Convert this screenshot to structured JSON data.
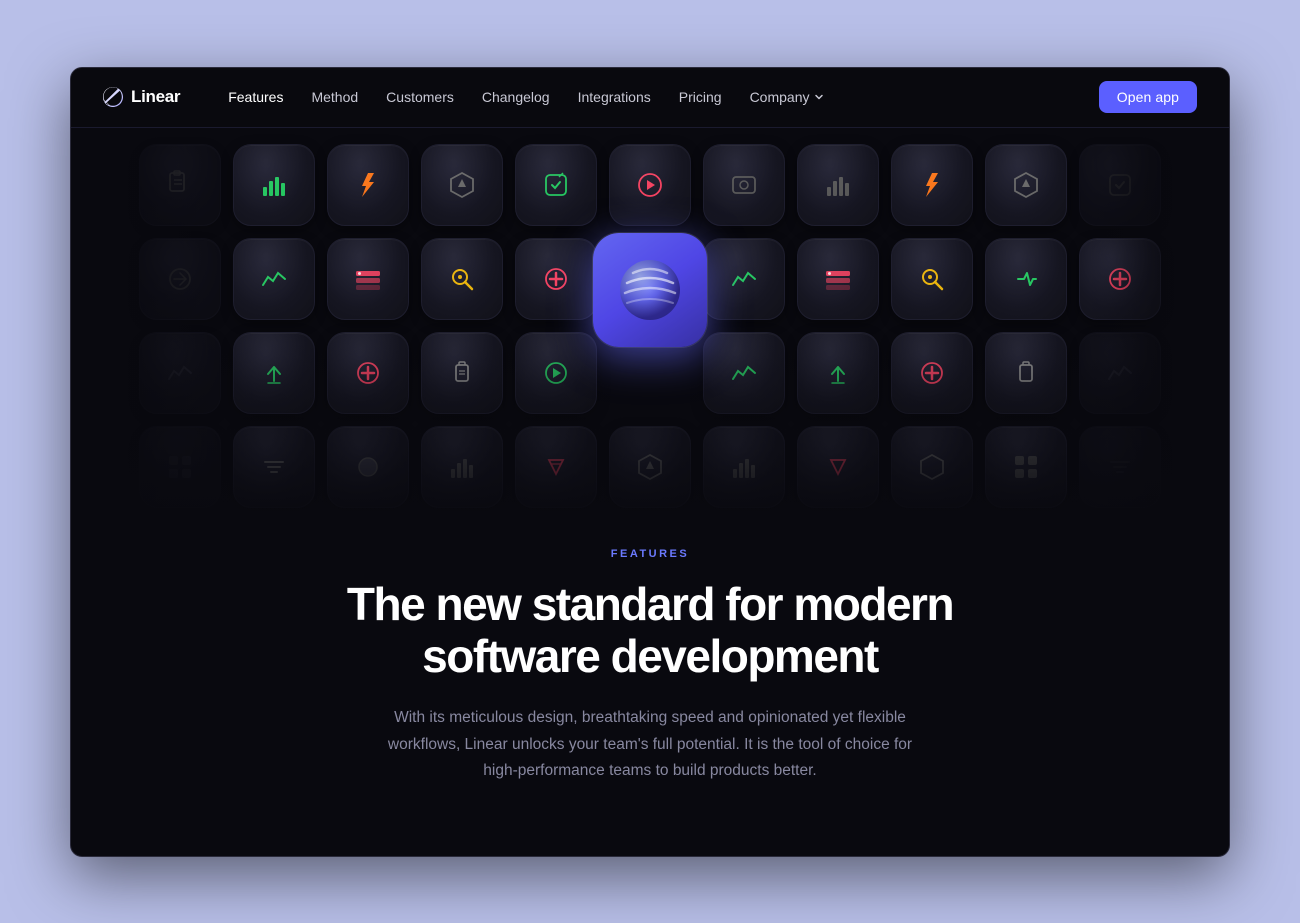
{
  "browser": {
    "background_color": "#b8bfe8"
  },
  "navbar": {
    "logo_text": "Linear",
    "nav_items": [
      {
        "label": "Features",
        "active": true,
        "has_dropdown": false
      },
      {
        "label": "Method",
        "active": false,
        "has_dropdown": false
      },
      {
        "label": "Customers",
        "active": false,
        "has_dropdown": false
      },
      {
        "label": "Changelog",
        "active": false,
        "has_dropdown": false
      },
      {
        "label": "Integrations",
        "active": false,
        "has_dropdown": false
      },
      {
        "label": "Pricing",
        "active": false,
        "has_dropdown": false
      },
      {
        "label": "Company",
        "active": false,
        "has_dropdown": true
      }
    ],
    "cta_label": "Open app"
  },
  "hero": {
    "label": "FEATURES",
    "title": "The new standard for modern software development",
    "subtitle": "With its meticulous design, breathtaking speed and opinionated yet flexible workflows, Linear unlocks your team's full potential. It is the tool of choice for high-performance teams to build products better."
  },
  "icon_grid": {
    "rows": [
      [
        {
          "icon": "📋",
          "color": "#888",
          "dim": true
        },
        {
          "icon": "📊",
          "color": "#22c55e"
        },
        {
          "icon": "⚡",
          "color": "#f97316"
        },
        {
          "icon": "🛡",
          "color": "#888"
        },
        {
          "icon": "✏️",
          "color": "#22c55e"
        },
        {
          "icon": "▶",
          "color": "#f43f5e"
        },
        {
          "icon": "📸",
          "color": "#888"
        },
        {
          "icon": "📊",
          "color": "#888"
        },
        {
          "icon": "⚡",
          "color": "#f97316"
        },
        {
          "icon": "🛡",
          "color": "#888"
        },
        {
          "icon": "✏️",
          "color": "#888",
          "dim": true
        }
      ],
      [
        {
          "icon": "→",
          "color": "#888",
          "dim": true
        },
        {
          "icon": "📈",
          "color": "#22c55e"
        },
        {
          "icon": "⌨",
          "color": "#f43f5e"
        },
        {
          "icon": "🔑",
          "color": "#eab308"
        },
        {
          "icon": "➕",
          "color": "#f43f5e"
        },
        {
          "icon": "HERO",
          "color": "",
          "is_hero": true
        },
        {
          "icon": "📈",
          "color": "#22c55e"
        },
        {
          "icon": "⌨",
          "color": "#f43f5e"
        },
        {
          "icon": "🔑",
          "color": "#eab308"
        },
        {
          "icon": "⇄",
          "color": "#22c55e"
        },
        {
          "icon": "➕",
          "color": "#f43f5e"
        }
      ],
      [
        {
          "icon": "〜",
          "color": "#22c55e",
          "dim": true
        },
        {
          "icon": "⬇",
          "color": "#22c55e"
        },
        {
          "icon": "➕",
          "color": "#f43f5e"
        },
        {
          "icon": "🔒",
          "color": "#888"
        },
        {
          "icon": "▶",
          "color": "#22c55e"
        },
        {
          "icon": "",
          "color": "",
          "empty": true
        },
        {
          "icon": "〜",
          "color": "#22c55e"
        },
        {
          "icon": "⬇",
          "color": "#22c55e"
        },
        {
          "icon": "➕",
          "color": "#f43f5e"
        },
        {
          "icon": "🔒",
          "color": "#888"
        },
        {
          "icon": "〜",
          "color": "#22c55e",
          "dim": true
        }
      ],
      [
        {
          "icon": "▪▪",
          "color": "#888",
          "dim": true
        },
        {
          "icon": "≡",
          "color": "#888"
        },
        {
          "icon": "●",
          "color": "#888"
        },
        {
          "icon": "📊",
          "color": "#888"
        },
        {
          "icon": "📦",
          "color": "#f43f5e"
        },
        {
          "icon": "🛡",
          "color": "#888"
        },
        {
          "icon": "📊",
          "color": "#888"
        },
        {
          "icon": "📦",
          "color": "#f43f5e"
        },
        {
          "icon": "🛡",
          "color": "#888"
        },
        {
          "icon": "▦",
          "color": "#888"
        },
        {
          "icon": "≡",
          "color": "#888",
          "dim": true
        }
      ]
    ]
  }
}
